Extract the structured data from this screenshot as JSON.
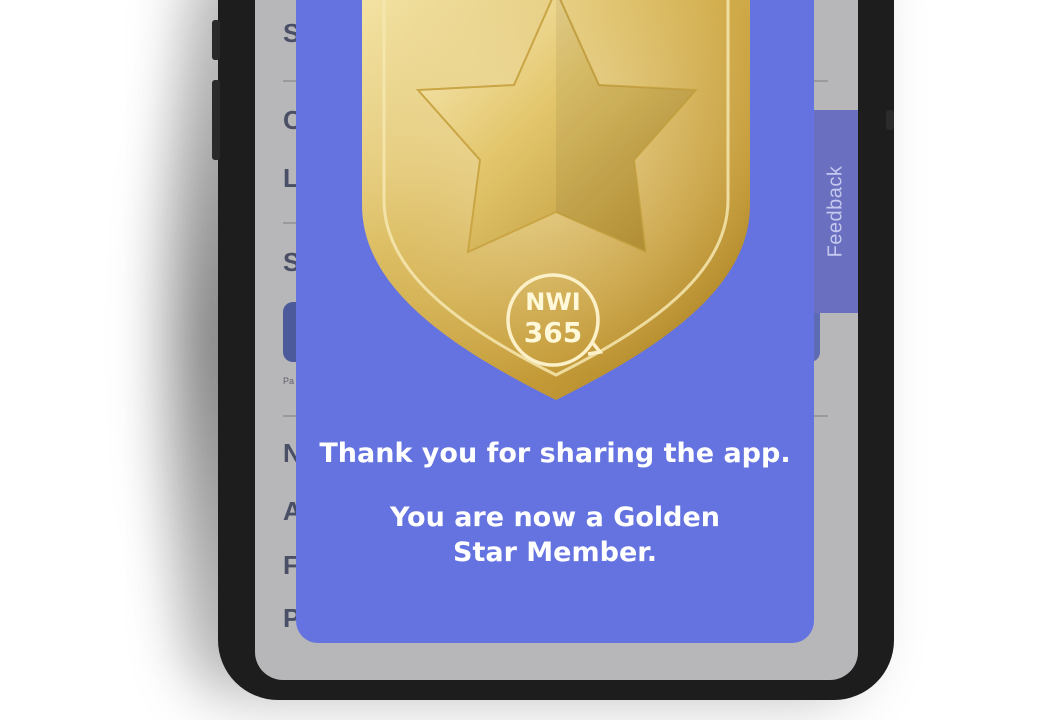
{
  "background_app": {
    "letters": [
      "S",
      "C",
      "L",
      "S",
      "N",
      "A",
      "F",
      "P"
    ],
    "small_text": "Pa"
  },
  "feedback_tab": {
    "label": "Feedback"
  },
  "badge": {
    "logo_line1": "NWI",
    "logo_line2": "365",
    "icon": "star-shield-badge-icon"
  },
  "modal": {
    "line1": "Thank you for sharing the app.",
    "line2": "You are now a Golden Star Member."
  },
  "colors": {
    "modal_bg": "#6473e0",
    "feedback_bg": "#6a6fbf",
    "gold": "#d9b94f"
  }
}
